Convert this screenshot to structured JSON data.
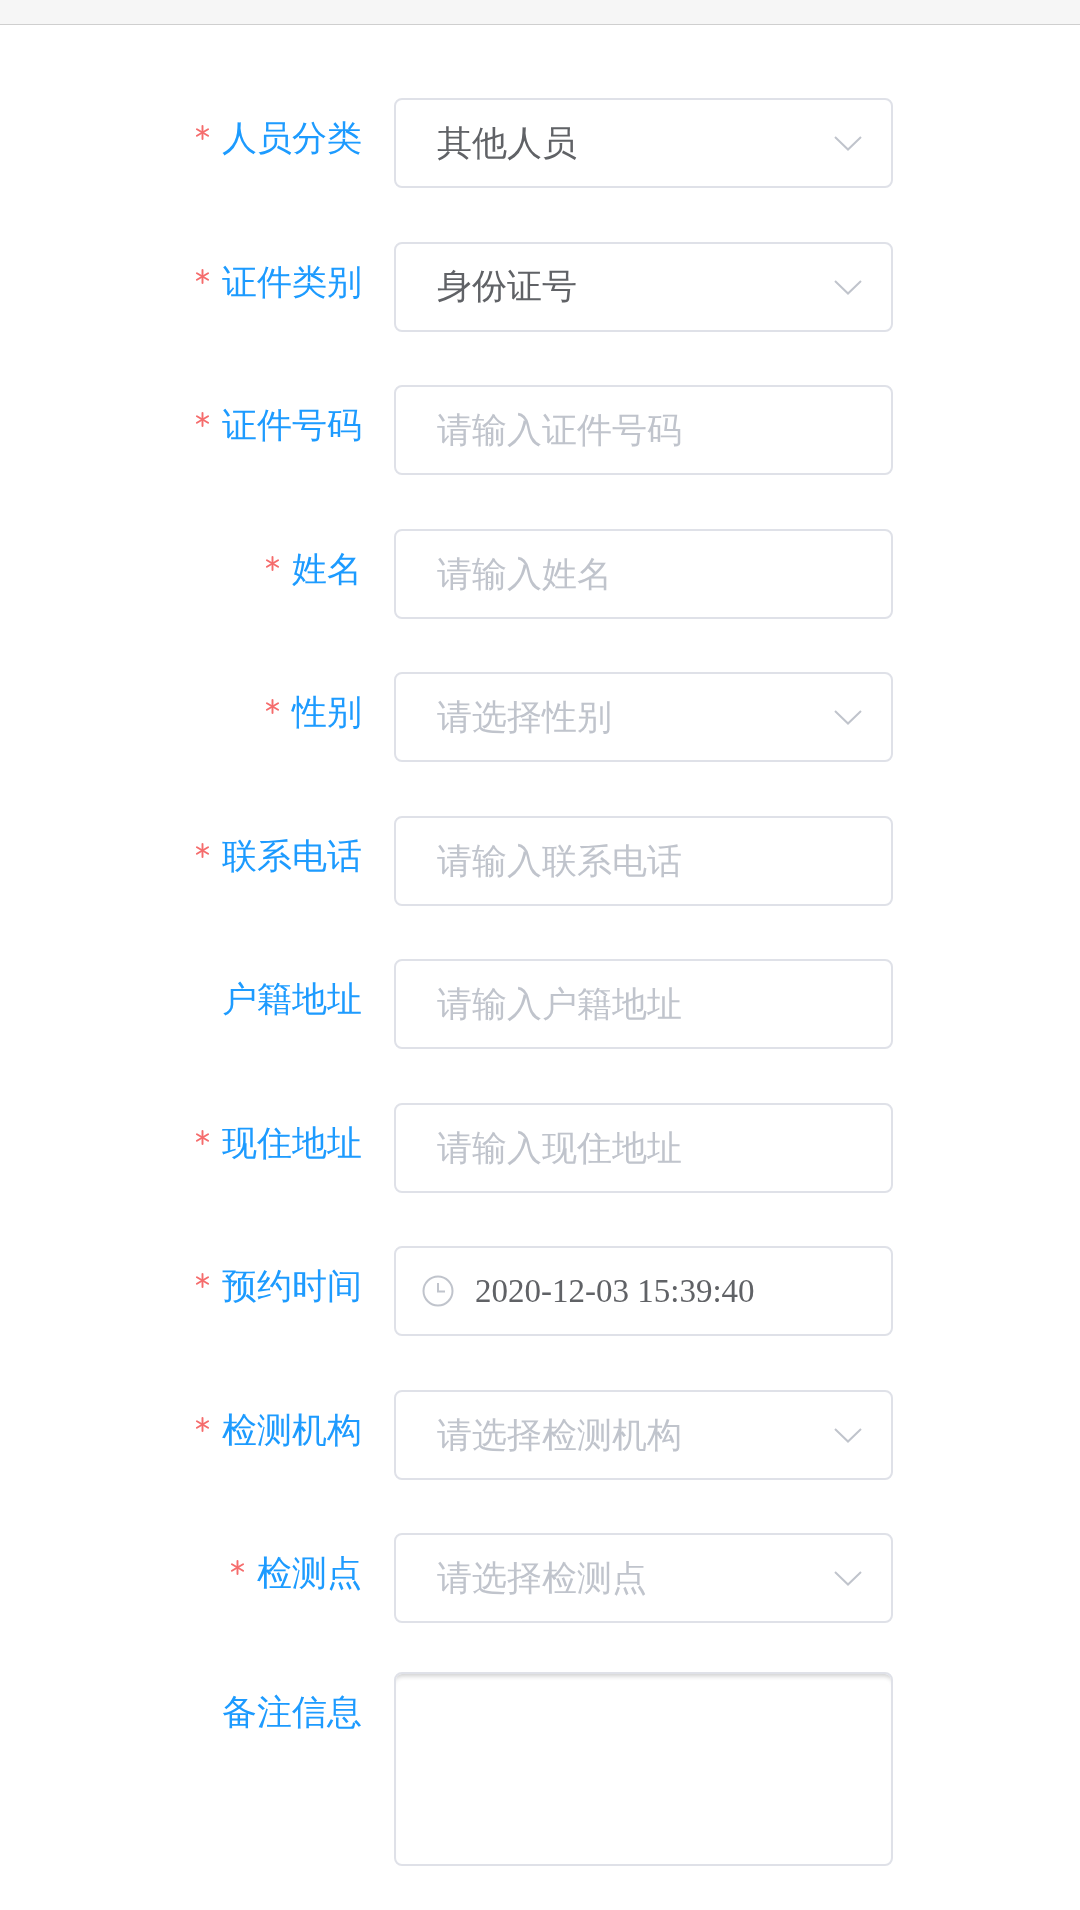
{
  "form": {
    "fields": [
      {
        "label": "人员分类",
        "required": true,
        "kind": "select",
        "value": "其他人员"
      },
      {
        "label": "证件类别",
        "required": true,
        "kind": "select",
        "value": "身份证号"
      },
      {
        "label": "证件号码",
        "required": true,
        "kind": "input",
        "placeholder": "请输入证件号码"
      },
      {
        "label": "姓名",
        "required": true,
        "kind": "input",
        "placeholder": "请输入姓名"
      },
      {
        "label": "性别",
        "required": true,
        "kind": "select",
        "placeholder": "请选择性别"
      },
      {
        "label": "联系电话",
        "required": true,
        "kind": "input",
        "placeholder": "请输入联系电话"
      },
      {
        "label": "户籍地址",
        "required": false,
        "kind": "input",
        "placeholder": "请输入户籍地址"
      },
      {
        "label": "现住地址",
        "required": true,
        "kind": "input",
        "placeholder": "请输入现住地址"
      },
      {
        "label": "预约时间",
        "required": true,
        "kind": "datetime",
        "value": "2020-12-03 15:39:40"
      },
      {
        "label": "检测机构",
        "required": true,
        "kind": "select",
        "placeholder": "请选择检测机构"
      },
      {
        "label": "检测点",
        "required": true,
        "kind": "select",
        "placeholder": "请选择检测点"
      },
      {
        "label": "备注信息",
        "required": false,
        "kind": "textarea"
      }
    ]
  }
}
